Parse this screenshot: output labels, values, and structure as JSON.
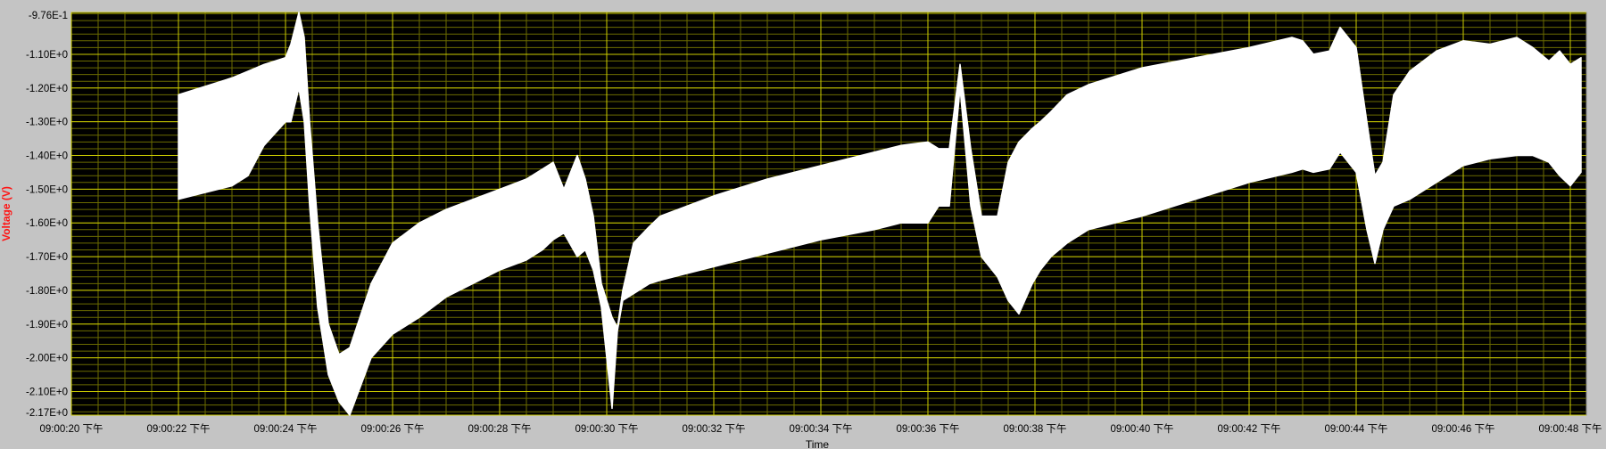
{
  "chart_data": {
    "type": "line",
    "title": "",
    "xlabel": "Time",
    "ylabel": "Voltage (V)",
    "ylabel_color": "#ff1414",
    "plot_background": "#000000",
    "grid_major_color": "#cccc00",
    "grid_minor_color": "#6b6b00",
    "trace_color": "#ffffff",
    "grid": true,
    "x_tick_suffix": "下午",
    "xlim": [
      "09:00:20",
      "09:00:48.3"
    ],
    "ylim": [
      -2.17,
      -0.976
    ],
    "x_ticks": [
      "09:00:20 下午",
      "09:00:22 下午",
      "09:00:24 下午",
      "09:00:26 下午",
      "09:00:28 下午",
      "09:00:30 下午",
      "09:00:32 下午",
      "09:00:34 下午",
      "09:00:36 下午",
      "09:00:38 下午",
      "09:00:40 下午",
      "09:00:42 下午",
      "09:00:44 下午",
      "09:00:46 下午",
      "09:00:48 下午"
    ],
    "y_tick_values": [
      -0.976,
      -1.1,
      -1.2,
      -1.3,
      -1.4,
      -1.5,
      -1.6,
      -1.7,
      -1.8,
      -1.9,
      -2.0,
      -2.1,
      -2.17
    ],
    "y_ticks": [
      "-9.76E-1",
      "-1.10E+0",
      "-1.20E+0",
      "-1.30E+0",
      "-1.40E+0",
      "-1.50E+0",
      "-1.60E+0",
      "-1.70E+0",
      "-1.80E+0",
      "-1.90E+0",
      "-2.00E+0",
      "-2.10E+0",
      "-2.17E+0"
    ],
    "series": [
      {
        "style": "envelope",
        "x": [
          "09:00:22.0",
          "09:00:23.0",
          "09:00:23.3",
          "09:00:23.6",
          "09:00:24.0",
          "09:00:24.1",
          "09:00:24.25",
          "09:00:24.35",
          "09:00:24.45",
          "09:00:24.6",
          "09:00:24.8",
          "09:00:25.0",
          "09:00:25.2",
          "09:00:25.6",
          "09:00:26.0",
          "09:00:26.5",
          "09:00:27.0",
          "09:00:28.0",
          "09:00:28.5",
          "09:00:28.8",
          "09:00:29.0",
          "09:00:29.2",
          "09:00:29.45",
          "09:00:29.6",
          "09:00:29.75",
          "09:00:29.9",
          "09:00:30.1",
          "09:00:30.2",
          "09:00:30.3",
          "09:00:30.5",
          "09:00:30.8",
          "09:00:31.0",
          "09:00:32.0",
          "09:00:33.0",
          "09:00:34.0",
          "09:00:35.0",
          "09:00:35.5",
          "09:00:36.0",
          "09:00:36.2",
          "09:00:36.4",
          "09:00:36.6",
          "09:00:36.8",
          "09:00:37.0",
          "09:00:37.3",
          "09:00:37.5",
          "09:00:37.7",
          "09:00:37.95",
          "09:00:38.1",
          "09:00:38.3",
          "09:00:38.6",
          "09:00:39.0",
          "09:00:40.0",
          "09:00:41.0",
          "09:00:42.0",
          "09:00:42.8",
          "09:00:43.0",
          "09:00:43.2",
          "09:00:43.5",
          "09:00:43.7",
          "09:00:44.0",
          "09:00:44.2",
          "09:00:44.35",
          "09:00:44.5",
          "09:00:44.7",
          "09:00:45.0",
          "09:00:45.5",
          "09:00:46.0",
          "09:00:46.5",
          "09:00:47.0",
          "09:00:47.3",
          "09:00:47.6",
          "09:00:47.8",
          "09:00:48.0",
          "09:00:48.2"
        ],
        "y_max": [
          -1.22,
          -1.17,
          -1.15,
          -1.13,
          -1.11,
          -1.07,
          -0.976,
          -1.05,
          -1.3,
          -1.6,
          -1.9,
          -1.99,
          -1.97,
          -1.78,
          -1.66,
          -1.6,
          -1.56,
          -1.5,
          -1.47,
          -1.44,
          -1.42,
          -1.5,
          -1.4,
          -1.47,
          -1.58,
          -1.78,
          -1.88,
          -1.91,
          -1.8,
          -1.66,
          -1.61,
          -1.58,
          -1.52,
          -1.47,
          -1.43,
          -1.39,
          -1.37,
          -1.36,
          -1.38,
          -1.38,
          -1.13,
          -1.38,
          -1.58,
          -1.58,
          -1.42,
          -1.36,
          -1.32,
          -1.3,
          -1.27,
          -1.22,
          -1.19,
          -1.14,
          -1.11,
          -1.08,
          -1.05,
          -1.06,
          -1.1,
          -1.09,
          -1.02,
          -1.08,
          -1.3,
          -1.46,
          -1.42,
          -1.22,
          -1.15,
          -1.09,
          -1.06,
          -1.07,
          -1.05,
          -1.08,
          -1.12,
          -1.09,
          -1.13,
          -1.11
        ],
        "y_min": [
          -1.53,
          -1.49,
          -1.46,
          -1.37,
          -1.3,
          -1.3,
          -1.2,
          -1.3,
          -1.55,
          -1.85,
          -2.05,
          -2.13,
          -2.17,
          -2.0,
          -1.93,
          -1.88,
          -1.82,
          -1.74,
          -1.71,
          -1.68,
          -1.65,
          -1.63,
          -1.7,
          -1.68,
          -1.74,
          -1.85,
          -2.15,
          -1.92,
          -1.83,
          -1.81,
          -1.78,
          -1.77,
          -1.73,
          -1.69,
          -1.65,
          -1.62,
          -1.6,
          -1.6,
          -1.55,
          -1.55,
          -1.2,
          -1.55,
          -1.7,
          -1.76,
          -1.83,
          -1.87,
          -1.78,
          -1.74,
          -1.7,
          -1.66,
          -1.62,
          -1.58,
          -1.53,
          -1.48,
          -1.45,
          -1.44,
          -1.45,
          -1.44,
          -1.39,
          -1.45,
          -1.62,
          -1.72,
          -1.62,
          -1.55,
          -1.53,
          -1.48,
          -1.43,
          -1.41,
          -1.4,
          -1.4,
          -1.42,
          -1.46,
          -1.49,
          -1.45
        ]
      }
    ]
  }
}
